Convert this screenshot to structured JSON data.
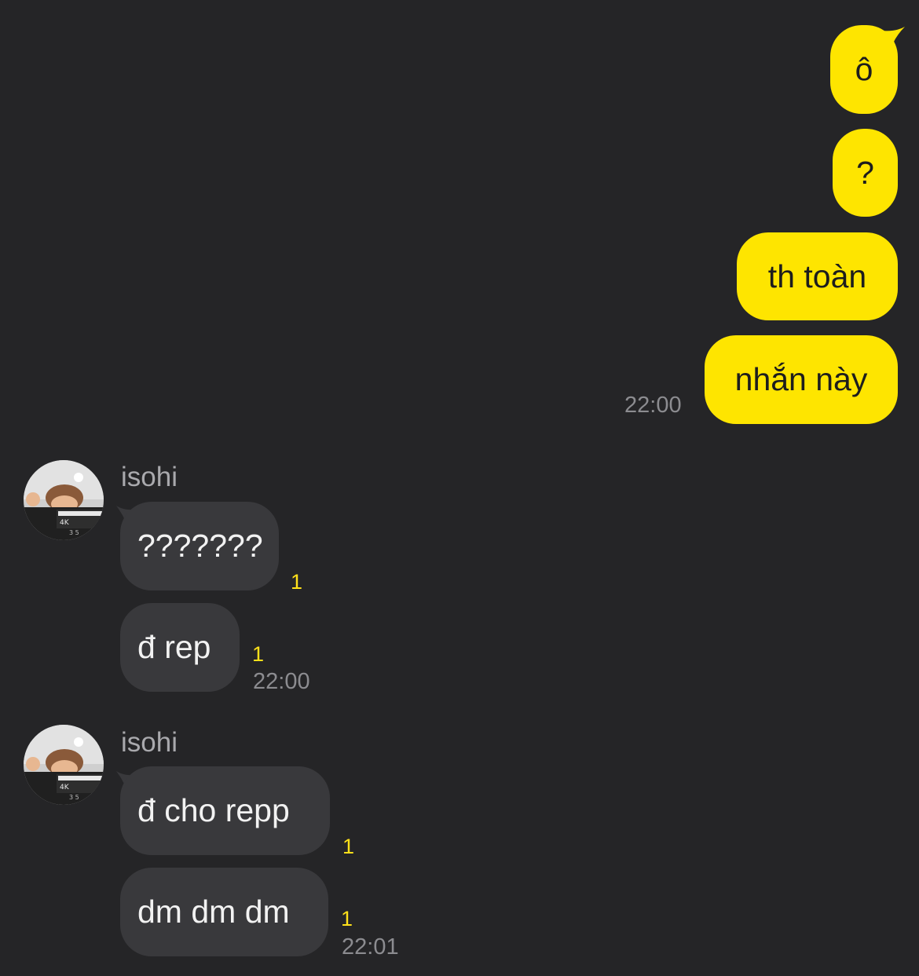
{
  "outgoing": {
    "messages": [
      "ô",
      "?",
      "th toàn",
      "nhắn này"
    ],
    "time": "22:00"
  },
  "incoming_groups": [
    {
      "sender": "isohi",
      "messages": [
        {
          "text": "???????",
          "unread": "1"
        },
        {
          "text": "đ rep",
          "unread": "1"
        }
      ],
      "time": "22:00"
    },
    {
      "sender": "isohi",
      "messages": [
        {
          "text": "đ cho repp",
          "unread": "1"
        },
        {
          "text": "dm dm dm",
          "unread": "1"
        }
      ],
      "time": "22:01"
    }
  ],
  "colors": {
    "background": "#252527",
    "outgoing_bubble": "#fee500",
    "incoming_bubble": "#39393c",
    "unread_count": "#ffe11a"
  }
}
